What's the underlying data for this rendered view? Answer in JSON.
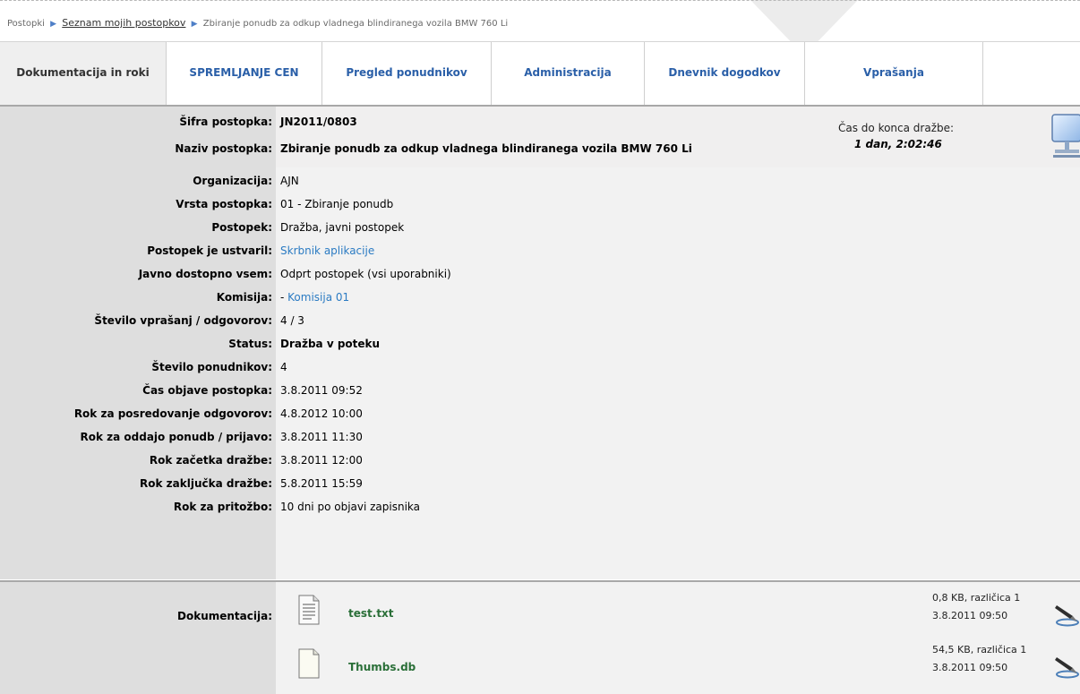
{
  "breadcrumb": {
    "root": "Postopki",
    "list_link": "Seznam mojih postopkov",
    "current": "Zbiranje ponudb za odkup vladnega blindiranega vozila BMW 760 Li"
  },
  "tabs": [
    {
      "label": "Dokumentacija in roki",
      "active": true
    },
    {
      "label": "SPREMLJANJE CEN"
    },
    {
      "label": "Pregled ponudnikov"
    },
    {
      "label": "Administracija"
    },
    {
      "label": "Dnevnik dogodkov"
    },
    {
      "label": "Vprašanja"
    }
  ],
  "header": {
    "sifra_label": "Šifra postopka:",
    "sifra_value": "JN2011/0803",
    "naziv_label": "Naziv postopka:",
    "naziv_value": "Zbiranje ponudb za odkup vladnega blindiranega vozila BMW 760 Li",
    "timer_label": "Čas do konca dražbe:",
    "timer_value": "1 dan, 2:02:46"
  },
  "details": [
    {
      "label": "Organizacija:",
      "value": "AJN"
    },
    {
      "label": "Vrsta postopka:",
      "value": "01 - Zbiranje ponudb"
    },
    {
      "label": "Postopek:",
      "value": "Dražba, javni postopek"
    },
    {
      "label": "Postopek je ustvaril:",
      "value": "Skrbnik aplikacije",
      "link": true
    },
    {
      "label": "Javno dostopno vsem:",
      "value": "Odprt postopek (vsi uporabniki)"
    },
    {
      "label": "Komisija:",
      "value_prefix": "- ",
      "value": "Komisija 01",
      "link": true
    },
    {
      "label": "Število vprašanj / odgovorov:",
      "value": "4 / 3"
    },
    {
      "label": "Status:",
      "value": "Dražba v poteku",
      "bold": true
    },
    {
      "label": "Število ponudnikov:",
      "value": "4"
    },
    {
      "label": "Čas objave postopka:",
      "value": "3.8.2011 09:52"
    },
    {
      "label": "Rok za posredovanje odgovorov:",
      "value": "4.8.2012 10:00"
    },
    {
      "label": "Rok za oddajo ponudb / prijavo:",
      "value": "3.8.2011 11:30"
    },
    {
      "label": "Rok začetka dražbe:",
      "value": "3.8.2011 12:00"
    },
    {
      "label": "Rok zaključka dražbe:",
      "value": "5.8.2011 15:59"
    },
    {
      "label": "Rok za pritožbo:",
      "value": "10 dni po objavi zapisnika"
    }
  ],
  "documents": {
    "label": "Dokumentacija:",
    "files": [
      {
        "name": "test.txt",
        "size": "0,8 KB, različica 1",
        "date": "3.8.2011 09:50"
      },
      {
        "name": "Thumbs.db",
        "size": "54,5 KB, različica 1",
        "date": "3.8.2011 09:50"
      }
    ]
  }
}
